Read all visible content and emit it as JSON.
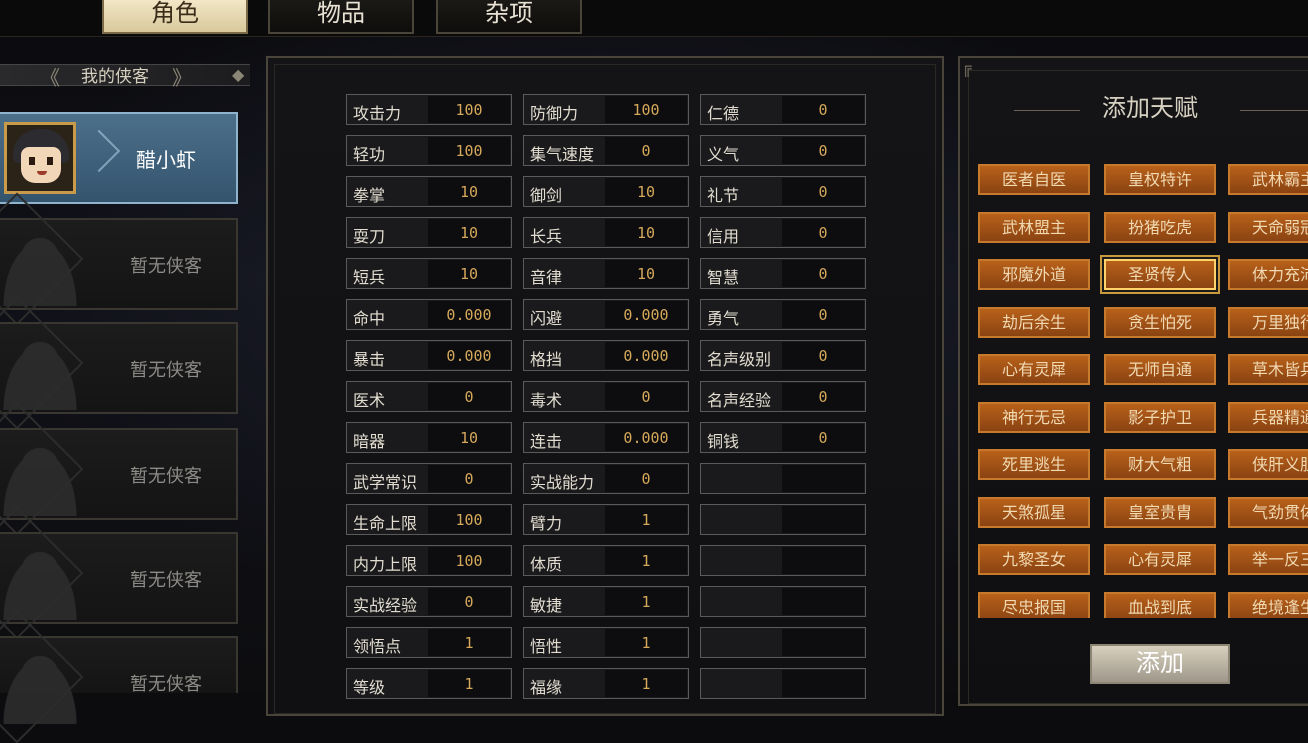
{
  "tabs": [
    "角色",
    "物品",
    "杂项"
  ],
  "roster": {
    "title": "我的侠客",
    "slots": [
      "醋小虾",
      "暂无侠客",
      "暂无侠客",
      "暂无侠客",
      "暂无侠客",
      "暂无侠客"
    ]
  },
  "stats": [
    [
      {
        "label": "攻击力",
        "value": "100"
      },
      {
        "label": "防御力",
        "value": "100"
      },
      {
        "label": "仁德",
        "value": "0"
      }
    ],
    [
      {
        "label": "轻功",
        "value": "100"
      },
      {
        "label": "集气速度",
        "value": "0"
      },
      {
        "label": "义气",
        "value": "0"
      }
    ],
    [
      {
        "label": "拳掌",
        "value": "10"
      },
      {
        "label": "御剑",
        "value": "10"
      },
      {
        "label": "礼节",
        "value": "0"
      }
    ],
    [
      {
        "label": "耍刀",
        "value": "10"
      },
      {
        "label": "长兵",
        "value": "10"
      },
      {
        "label": "信用",
        "value": "0"
      }
    ],
    [
      {
        "label": "短兵",
        "value": "10"
      },
      {
        "label": "音律",
        "value": "10"
      },
      {
        "label": "智慧",
        "value": "0"
      }
    ],
    [
      {
        "label": "命中",
        "value": "0.000"
      },
      {
        "label": "闪避",
        "value": "0.000"
      },
      {
        "label": "勇气",
        "value": "0"
      }
    ],
    [
      {
        "label": "暴击",
        "value": "0.000"
      },
      {
        "label": "格挡",
        "value": "0.000"
      },
      {
        "label": "名声级别",
        "value": "0"
      }
    ],
    [
      {
        "label": "医术",
        "value": "0"
      },
      {
        "label": "毒术",
        "value": "0"
      },
      {
        "label": "名声经验",
        "value": "0"
      }
    ],
    [
      {
        "label": "暗器",
        "value": "10"
      },
      {
        "label": "连击",
        "value": "0.000"
      },
      {
        "label": "铜钱",
        "value": "0"
      }
    ],
    [
      {
        "label": "武学常识",
        "value": "0"
      },
      {
        "label": "实战能力",
        "value": "0"
      },
      {
        "label": "",
        "value": ""
      }
    ],
    [
      {
        "label": "生命上限",
        "value": "100"
      },
      {
        "label": "臂力",
        "value": "1"
      },
      {
        "label": "",
        "value": ""
      }
    ],
    [
      {
        "label": "内力上限",
        "value": "100"
      },
      {
        "label": "体质",
        "value": "1"
      },
      {
        "label": "",
        "value": ""
      }
    ],
    [
      {
        "label": "实战经验",
        "value": "0"
      },
      {
        "label": "敏捷",
        "value": "1"
      },
      {
        "label": "",
        "value": ""
      }
    ],
    [
      {
        "label": "领悟点",
        "value": "1"
      },
      {
        "label": "悟性",
        "value": "1"
      },
      {
        "label": "",
        "value": ""
      }
    ],
    [
      {
        "label": "等级",
        "value": "1"
      },
      {
        "label": "福缘",
        "value": "1"
      },
      {
        "label": "",
        "value": ""
      }
    ]
  ],
  "talents": {
    "title": "添加天赋",
    "items": [
      [
        "医者自医",
        "皇权特许",
        "武林霸主"
      ],
      [
        "武林盟主",
        "扮猪吃虎",
        "天命弱冠"
      ],
      [
        "邪魔外道",
        "圣贤传人",
        "体力充沛"
      ],
      [
        "劫后余生",
        "贪生怕死",
        "万里独行"
      ],
      [
        "心有灵犀",
        "无师自通",
        "草木皆兵"
      ],
      [
        "神行无忌",
        "影子护卫",
        "兵器精通"
      ],
      [
        "死里逃生",
        "财大气粗",
        "侠肝义胆"
      ],
      [
        "天煞孤星",
        "皇室贵胄",
        "气劲贯体"
      ],
      [
        "九黎圣女",
        "心有灵犀",
        "举一反三"
      ],
      [
        "尽忠报国",
        "血战到底",
        "绝境逢生"
      ]
    ],
    "selected": "圣贤传人",
    "add_button": "添加"
  }
}
